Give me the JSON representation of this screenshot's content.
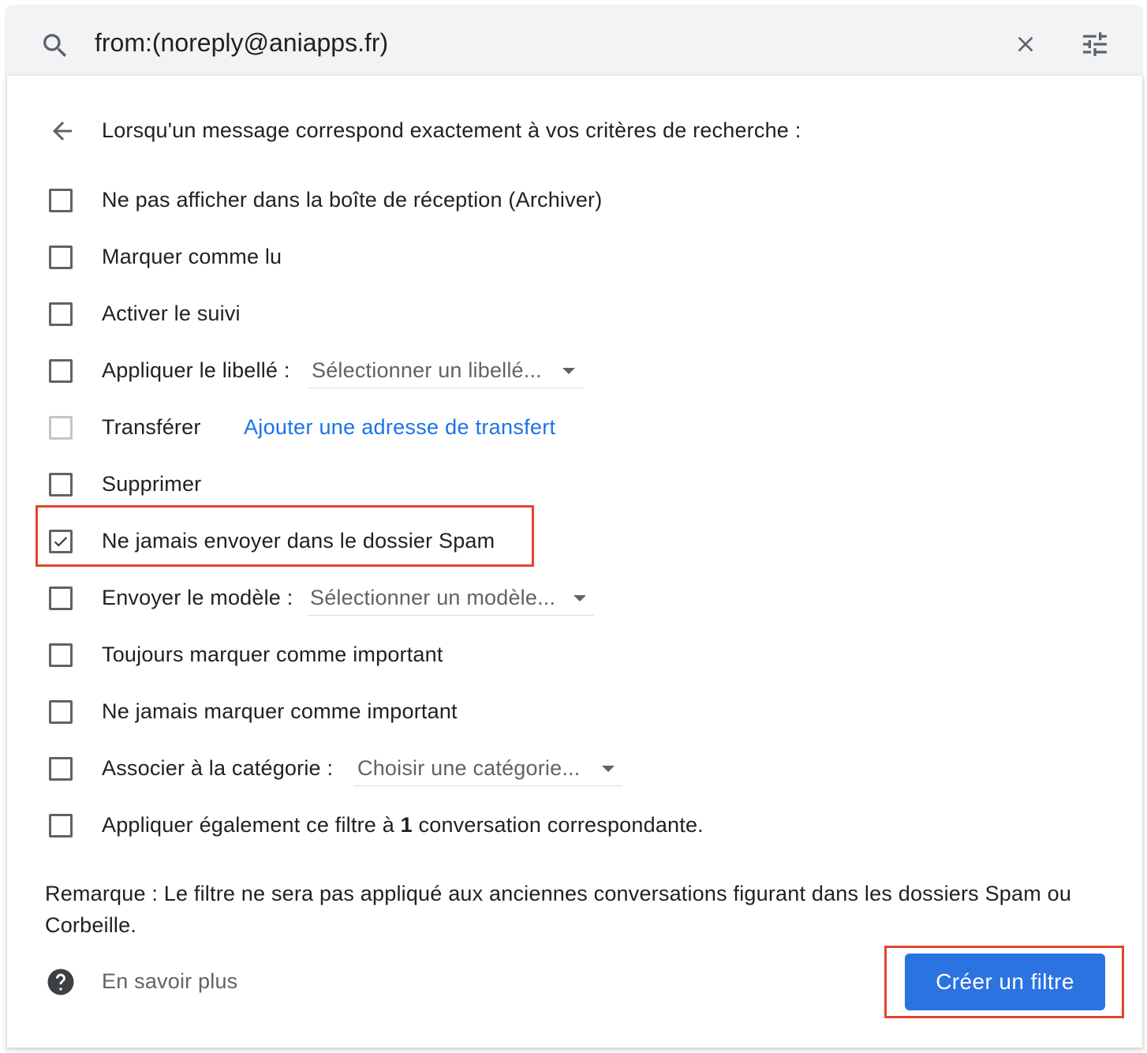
{
  "search": {
    "query": "from:(noreply@aniapps.fr)",
    "icon": "search-icon",
    "clear_icon": "close-icon",
    "options_icon": "tune-icon"
  },
  "filter": {
    "heading": "Lorsqu'un message correspond exactement à vos critères de recherche :",
    "options": [
      {
        "label": "Ne pas afficher dans la boîte de réception (Archiver)",
        "checked": false
      },
      {
        "label": "Marquer comme lu",
        "checked": false
      },
      {
        "label": "Activer le suivi",
        "checked": false
      },
      {
        "label": "Appliquer le libellé :",
        "checked": false,
        "dropdown": "Sélectionner un libellé..."
      },
      {
        "label": "Transférer",
        "checked": false,
        "disabled": true,
        "link": "Ajouter une adresse de transfert"
      },
      {
        "label": "Supprimer",
        "checked": false
      },
      {
        "label": "Ne jamais envoyer dans le dossier Spam",
        "checked": true
      },
      {
        "label": "Envoyer le modèle :",
        "checked": false,
        "dropdown": "Sélectionner un modèle..."
      },
      {
        "label": "Toujours marquer comme important",
        "checked": false
      },
      {
        "label": "Ne jamais marquer comme important",
        "checked": false
      },
      {
        "label": "Associer à la catégorie :",
        "checked": false,
        "dropdown": "Choisir une catégorie..."
      },
      {
        "label_before": "Appliquer également ce filtre à ",
        "label_bold": "1",
        "label_after": " conversation correspondante.",
        "checked": false
      }
    ],
    "note": "Remarque : Le filtre ne sera pas appliqué aux anciennes conversations figurant dans les dossiers Spam ou Corbeille.",
    "help_label": "En savoir plus",
    "create_button": "Créer un filtre"
  },
  "colors": {
    "accent": "#1a73e8",
    "button": "#2b73e1",
    "highlight": "#e0462d"
  }
}
